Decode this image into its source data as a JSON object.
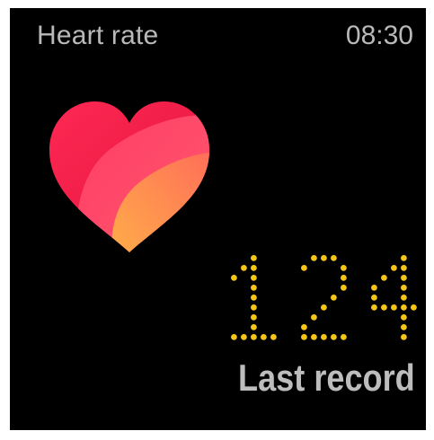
{
  "header": {
    "title": "Heart rate",
    "time": "08:30"
  },
  "reading": {
    "bpm": "124",
    "label": "Last record"
  },
  "icons": {
    "main": "heart-icon"
  },
  "colors": {
    "background": "#000000",
    "text_secondary": "#b9b9b9",
    "digits": "#f5c518",
    "heart_red": "#e8133f",
    "heart_pink": "#ff4f6d",
    "heart_orange": "#ffa04a"
  }
}
